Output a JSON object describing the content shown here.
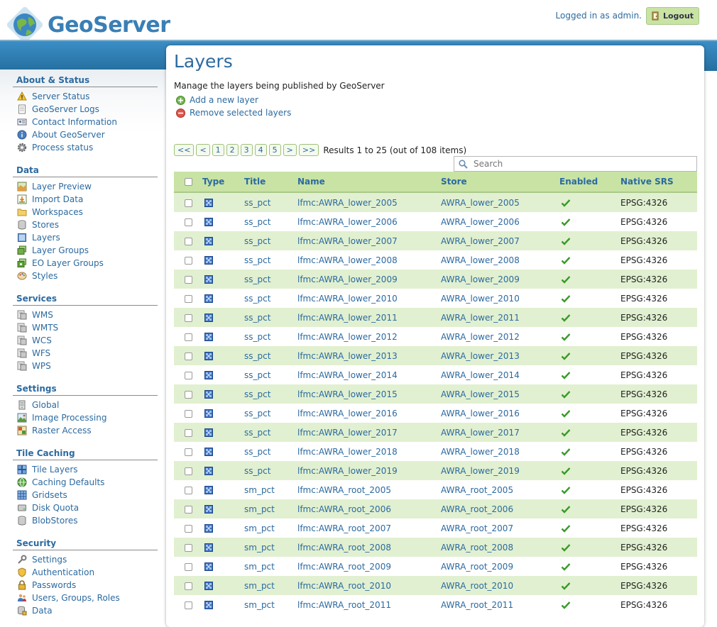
{
  "header": {
    "brand": "GeoServer",
    "login_status": "Logged in as admin.",
    "logout_label": "Logout"
  },
  "sidebar": {
    "sections": [
      {
        "title": "About & Status",
        "items": [
          {
            "label": "Server Status",
            "icon": "warning-icon"
          },
          {
            "label": "GeoServer Logs",
            "icon": "document-icon"
          },
          {
            "label": "Contact Information",
            "icon": "contact-card-icon"
          },
          {
            "label": "About GeoServer",
            "icon": "info-icon"
          },
          {
            "label": "Process status",
            "icon": "gear-icon"
          }
        ]
      },
      {
        "title": "Data",
        "items": [
          {
            "label": "Layer Preview",
            "icon": "map-preview-icon"
          },
          {
            "label": "Import Data",
            "icon": "import-icon"
          },
          {
            "label": "Workspaces",
            "icon": "folder-icon"
          },
          {
            "label": "Stores",
            "icon": "database-icon"
          },
          {
            "label": "Layers",
            "icon": "layer-icon"
          },
          {
            "label": "Layer Groups",
            "icon": "layer-group-icon"
          },
          {
            "label": "EO Layer Groups",
            "icon": "eo-layer-group-icon"
          },
          {
            "label": "Styles",
            "icon": "palette-icon"
          }
        ]
      },
      {
        "title": "Services",
        "items": [
          {
            "label": "WMS",
            "icon": "service-icon"
          },
          {
            "label": "WMTS",
            "icon": "service-icon"
          },
          {
            "label": "WCS",
            "icon": "service-icon"
          },
          {
            "label": "WFS",
            "icon": "service-icon"
          },
          {
            "label": "WPS",
            "icon": "service-icon"
          }
        ]
      },
      {
        "title": "Settings",
        "items": [
          {
            "label": "Global",
            "icon": "server-icon"
          },
          {
            "label": "Image Processing",
            "icon": "image-icon"
          },
          {
            "label": "Raster Access",
            "icon": "raster-icon"
          }
        ]
      },
      {
        "title": "Tile Caching",
        "items": [
          {
            "label": "Tile Layers",
            "icon": "tiles-icon"
          },
          {
            "label": "Caching Defaults",
            "icon": "globe-grid-icon"
          },
          {
            "label": "Gridsets",
            "icon": "grid-icon"
          },
          {
            "label": "Disk Quota",
            "icon": "disk-icon"
          },
          {
            "label": "BlobStores",
            "icon": "database-icon"
          }
        ]
      },
      {
        "title": "Security",
        "items": [
          {
            "label": "Settings",
            "icon": "wrench-icon"
          },
          {
            "label": "Authentication",
            "icon": "shield-icon"
          },
          {
            "label": "Passwords",
            "icon": "lock-icon"
          },
          {
            "label": "Users, Groups, Roles",
            "icon": "users-icon"
          },
          {
            "label": "Data",
            "icon": "data-lock-icon"
          }
        ]
      }
    ]
  },
  "main": {
    "title": "Layers",
    "description": "Manage the layers being published by GeoServer",
    "add_label": "Add a new layer",
    "remove_label": "Remove selected layers",
    "pager": [
      "<<",
      "<",
      "1",
      "2",
      "3",
      "4",
      "5",
      ">",
      ">>"
    ],
    "results_text": "Results 1 to 25 (out of 108 items)",
    "search_placeholder": "Search",
    "columns": [
      "Type",
      "Title",
      "Name",
      "Store",
      "Enabled",
      "Native SRS"
    ],
    "rows": [
      {
        "title": "ss_pct",
        "name": "lfmc:AWRA_lower_2005",
        "store": "AWRA_lower_2005",
        "srs": "EPSG:4326"
      },
      {
        "title": "ss_pct",
        "name": "lfmc:AWRA_lower_2006",
        "store": "AWRA_lower_2006",
        "srs": "EPSG:4326"
      },
      {
        "title": "ss_pct",
        "name": "lfmc:AWRA_lower_2007",
        "store": "AWRA_lower_2007",
        "srs": "EPSG:4326"
      },
      {
        "title": "ss_pct",
        "name": "lfmc:AWRA_lower_2008",
        "store": "AWRA_lower_2008",
        "srs": "EPSG:4326"
      },
      {
        "title": "ss_pct",
        "name": "lfmc:AWRA_lower_2009",
        "store": "AWRA_lower_2009",
        "srs": "EPSG:4326"
      },
      {
        "title": "ss_pct",
        "name": "lfmc:AWRA_lower_2010",
        "store": "AWRA_lower_2010",
        "srs": "EPSG:4326"
      },
      {
        "title": "ss_pct",
        "name": "lfmc:AWRA_lower_2011",
        "store": "AWRA_lower_2011",
        "srs": "EPSG:4326"
      },
      {
        "title": "ss_pct",
        "name": "lfmc:AWRA_lower_2012",
        "store": "AWRA_lower_2012",
        "srs": "EPSG:4326"
      },
      {
        "title": "ss_pct",
        "name": "lfmc:AWRA_lower_2013",
        "store": "AWRA_lower_2013",
        "srs": "EPSG:4326"
      },
      {
        "title": "ss_pct",
        "name": "lfmc:AWRA_lower_2014",
        "store": "AWRA_lower_2014",
        "srs": "EPSG:4326"
      },
      {
        "title": "ss_pct",
        "name": "lfmc:AWRA_lower_2015",
        "store": "AWRA_lower_2015",
        "srs": "EPSG:4326"
      },
      {
        "title": "ss_pct",
        "name": "lfmc:AWRA_lower_2016",
        "store": "AWRA_lower_2016",
        "srs": "EPSG:4326"
      },
      {
        "title": "ss_pct",
        "name": "lfmc:AWRA_lower_2017",
        "store": "AWRA_lower_2017",
        "srs": "EPSG:4326"
      },
      {
        "title": "ss_pct",
        "name": "lfmc:AWRA_lower_2018",
        "store": "AWRA_lower_2018",
        "srs": "EPSG:4326"
      },
      {
        "title": "ss_pct",
        "name": "lfmc:AWRA_lower_2019",
        "store": "AWRA_lower_2019",
        "srs": "EPSG:4326"
      },
      {
        "title": "sm_pct",
        "name": "lfmc:AWRA_root_2005",
        "store": "AWRA_root_2005",
        "srs": "EPSG:4326"
      },
      {
        "title": "sm_pct",
        "name": "lfmc:AWRA_root_2006",
        "store": "AWRA_root_2006",
        "srs": "EPSG:4326"
      },
      {
        "title": "sm_pct",
        "name": "lfmc:AWRA_root_2007",
        "store": "AWRA_root_2007",
        "srs": "EPSG:4326"
      },
      {
        "title": "sm_pct",
        "name": "lfmc:AWRA_root_2008",
        "store": "AWRA_root_2008",
        "srs": "EPSG:4326"
      },
      {
        "title": "sm_pct",
        "name": "lfmc:AWRA_root_2009",
        "store": "AWRA_root_2009",
        "srs": "EPSG:4326"
      },
      {
        "title": "sm_pct",
        "name": "lfmc:AWRA_root_2010",
        "store": "AWRA_root_2010",
        "srs": "EPSG:4326"
      },
      {
        "title": "sm_pct",
        "name": "lfmc:AWRA_root_2011",
        "store": "AWRA_root_2011",
        "srs": "EPSG:4326"
      }
    ]
  },
  "colors": {
    "link": "#2c6aa0",
    "header_band": "#2f82b8",
    "table_header": "#c8e3a4",
    "row_alt": "#e1f0d0",
    "enabled_check": "#3a9a2a"
  }
}
